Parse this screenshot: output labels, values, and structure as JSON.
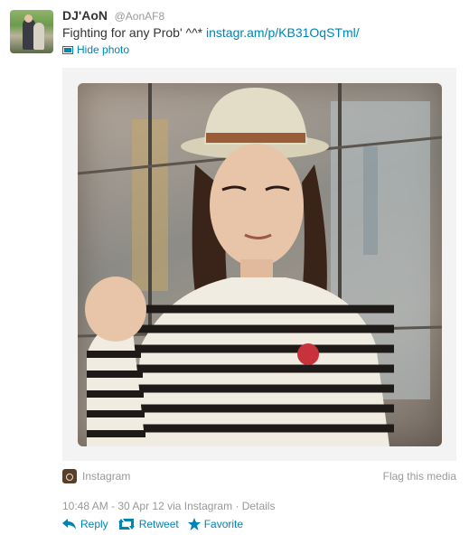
{
  "tweet": {
    "fullname": "DJ'AoN",
    "username": "@AonAF8",
    "text": "Fighting for any Prob' ^^*",
    "link": "instagr.am/p/KB31OqSTml/",
    "hide_photo": "Hide photo",
    "source_label": "Instagram",
    "flag_media": "Flag this media",
    "timestamp": "10:48 AM - 30 Apr 12 via Instagram · Details",
    "actions": {
      "reply": "Reply",
      "retweet": "Retweet",
      "favorite": "Favorite"
    }
  },
  "colors": {
    "link": "#0084b4",
    "muted": "#999999",
    "text": "#333333"
  },
  "icons": [
    "photo-icon",
    "instagram-icon",
    "reply-icon",
    "retweet-icon",
    "favorite-icon"
  ]
}
